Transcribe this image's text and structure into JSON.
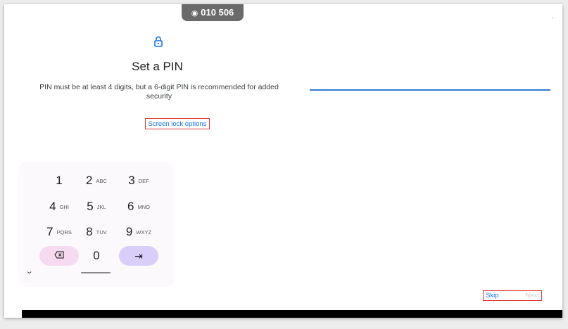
{
  "status": {
    "code": "010 506",
    "icon": "cast-icon"
  },
  "header": {
    "lock_icon": "lock-icon",
    "title": "Set a PIN"
  },
  "body": {
    "description": "PIN must be at least 4 digits, but a 6-digit PIN is recommended for added security",
    "pin_value": "",
    "screen_lock_options": "Screen lock options"
  },
  "keypad": {
    "keys": [
      {
        "num": "1",
        "letters": ""
      },
      {
        "num": "2",
        "letters": "ABC"
      },
      {
        "num": "3",
        "letters": "DEF"
      },
      {
        "num": "4",
        "letters": "GHI"
      },
      {
        "num": "5",
        "letters": "JKL"
      },
      {
        "num": "6",
        "letters": "MNO"
      },
      {
        "num": "7",
        "letters": "PQRS"
      },
      {
        "num": "8",
        "letters": "TUV"
      },
      {
        "num": "9",
        "letters": "WXYZ"
      }
    ],
    "zero": "0",
    "delete_icon": "backspace-icon",
    "next_icon": "tab-arrow-icon",
    "hide_icon": "chevron-down-icon"
  },
  "footer": {
    "skip": "Skip",
    "next": "Next"
  },
  "colors": {
    "accent": "#1a73e8",
    "pin_line": "#2e7bd4",
    "delete_key": "#f6dbf0",
    "next_key": "#d9cdfa",
    "annotation": "#e03535"
  }
}
